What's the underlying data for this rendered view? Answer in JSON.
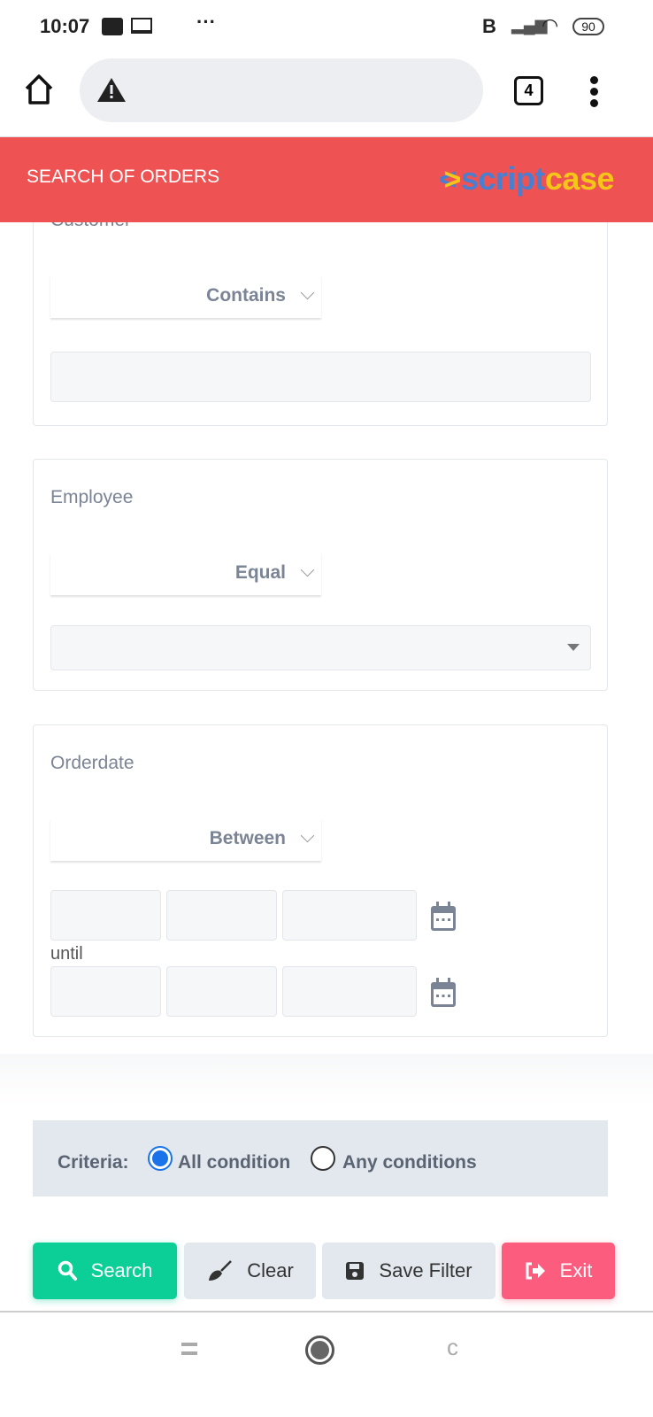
{
  "status_bar": {
    "time": "10:07",
    "battery": "90",
    "network": "B"
  },
  "browser": {
    "tab_count": "4"
  },
  "header": {
    "title": "SEARCH OF ORDERS",
    "logo_text_1": "script",
    "logo_text_2": "case"
  },
  "fields": [
    {
      "label": "Customer",
      "operator": "Contains",
      "value": ""
    },
    {
      "label": "Employee",
      "operator": "Equal",
      "value": ""
    },
    {
      "label": "Orderdate",
      "operator": "Between",
      "until_label": "until"
    }
  ],
  "criteria": {
    "label": "Criteria:",
    "options": [
      "All condition",
      "Any conditions"
    ],
    "selected": "All condition"
  },
  "buttons": {
    "search": "Search",
    "clear": "Clear",
    "save_filter": "Save Filter",
    "exit": "Exit"
  },
  "colors": {
    "header": "#ee5253",
    "search": "#0ccf97",
    "exit": "#fc5c7d",
    "accent": "#1a73e8"
  }
}
